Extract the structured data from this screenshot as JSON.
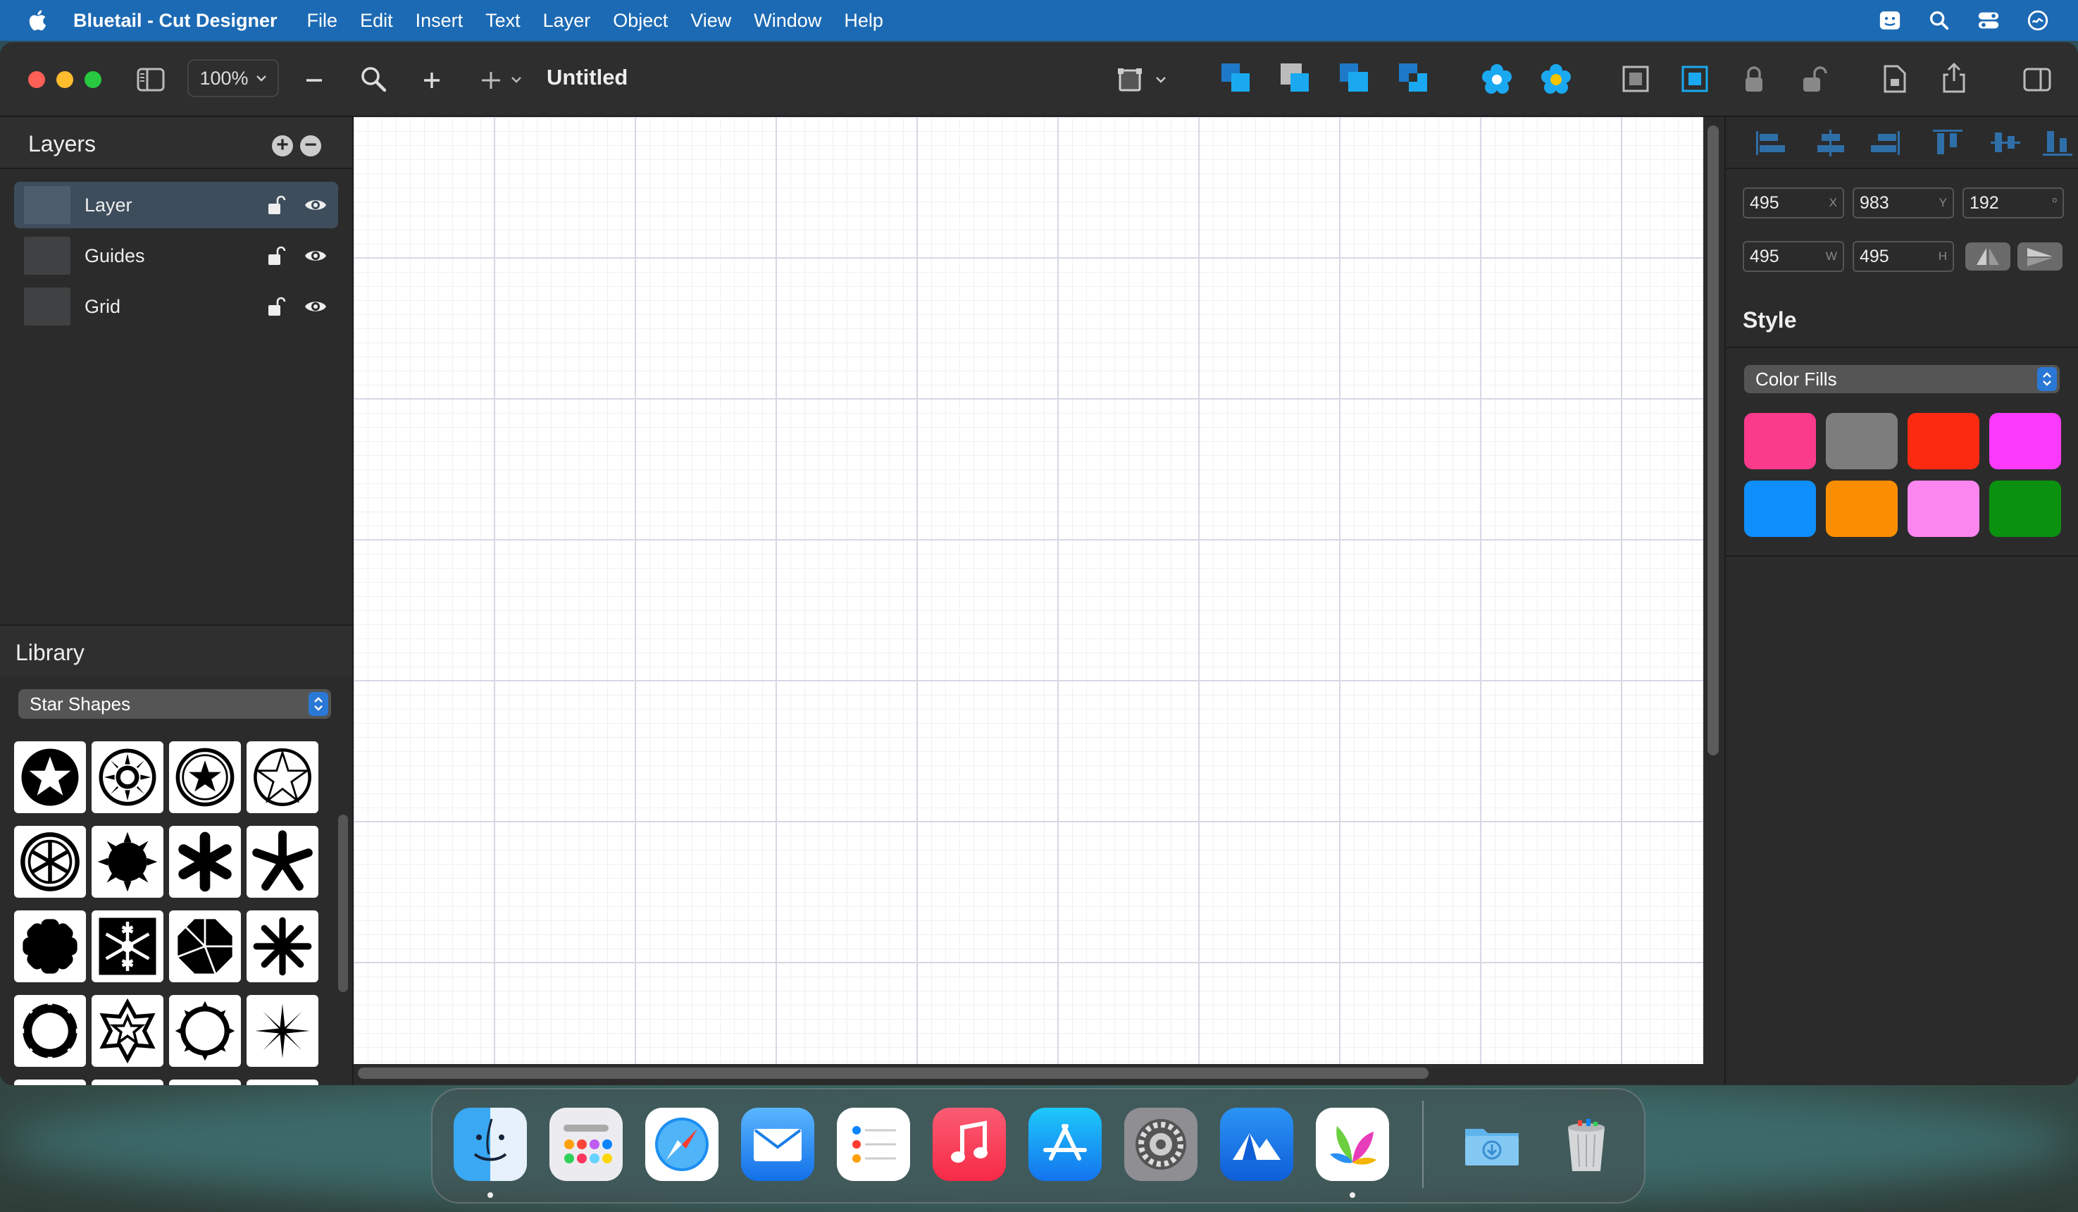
{
  "menubar": {
    "app_name": "Bluetail - Cut Designer",
    "items": [
      "File",
      "Edit",
      "Insert",
      "Text",
      "Layer",
      "Object",
      "View",
      "Window",
      "Help"
    ]
  },
  "toolbar": {
    "zoom": "100%",
    "document_title": "Untitled"
  },
  "layers": {
    "title": "Layers",
    "items": [
      {
        "name": "Layer",
        "selected": true
      },
      {
        "name": "Guides",
        "selected": false
      },
      {
        "name": "Grid",
        "selected": false
      }
    ]
  },
  "library": {
    "title": "Library",
    "category": "Star Shapes"
  },
  "inspector": {
    "x": "495",
    "x_unit": "X",
    "y": "983",
    "y_unit": "Y",
    "rotation": "192",
    "rotation_unit": "º",
    "width": "495",
    "width_unit": "W",
    "height": "495",
    "height_unit": "H"
  },
  "style": {
    "title": "Style",
    "fill_mode": "Color Fills",
    "swatches": [
      "#fa3a8a",
      "#7d7d7d",
      "#fb2a10",
      "#fb3afb",
      "#0f8ffb",
      "#fb8e00",
      "#fb86f0",
      "#0a9110"
    ]
  },
  "dock": {
    "apps": [
      "finder",
      "launchpad",
      "safari",
      "mail",
      "reminders",
      "music",
      "app-store",
      "system-settings",
      "altitude",
      "bluetail",
      "downloads",
      "trash"
    ]
  }
}
